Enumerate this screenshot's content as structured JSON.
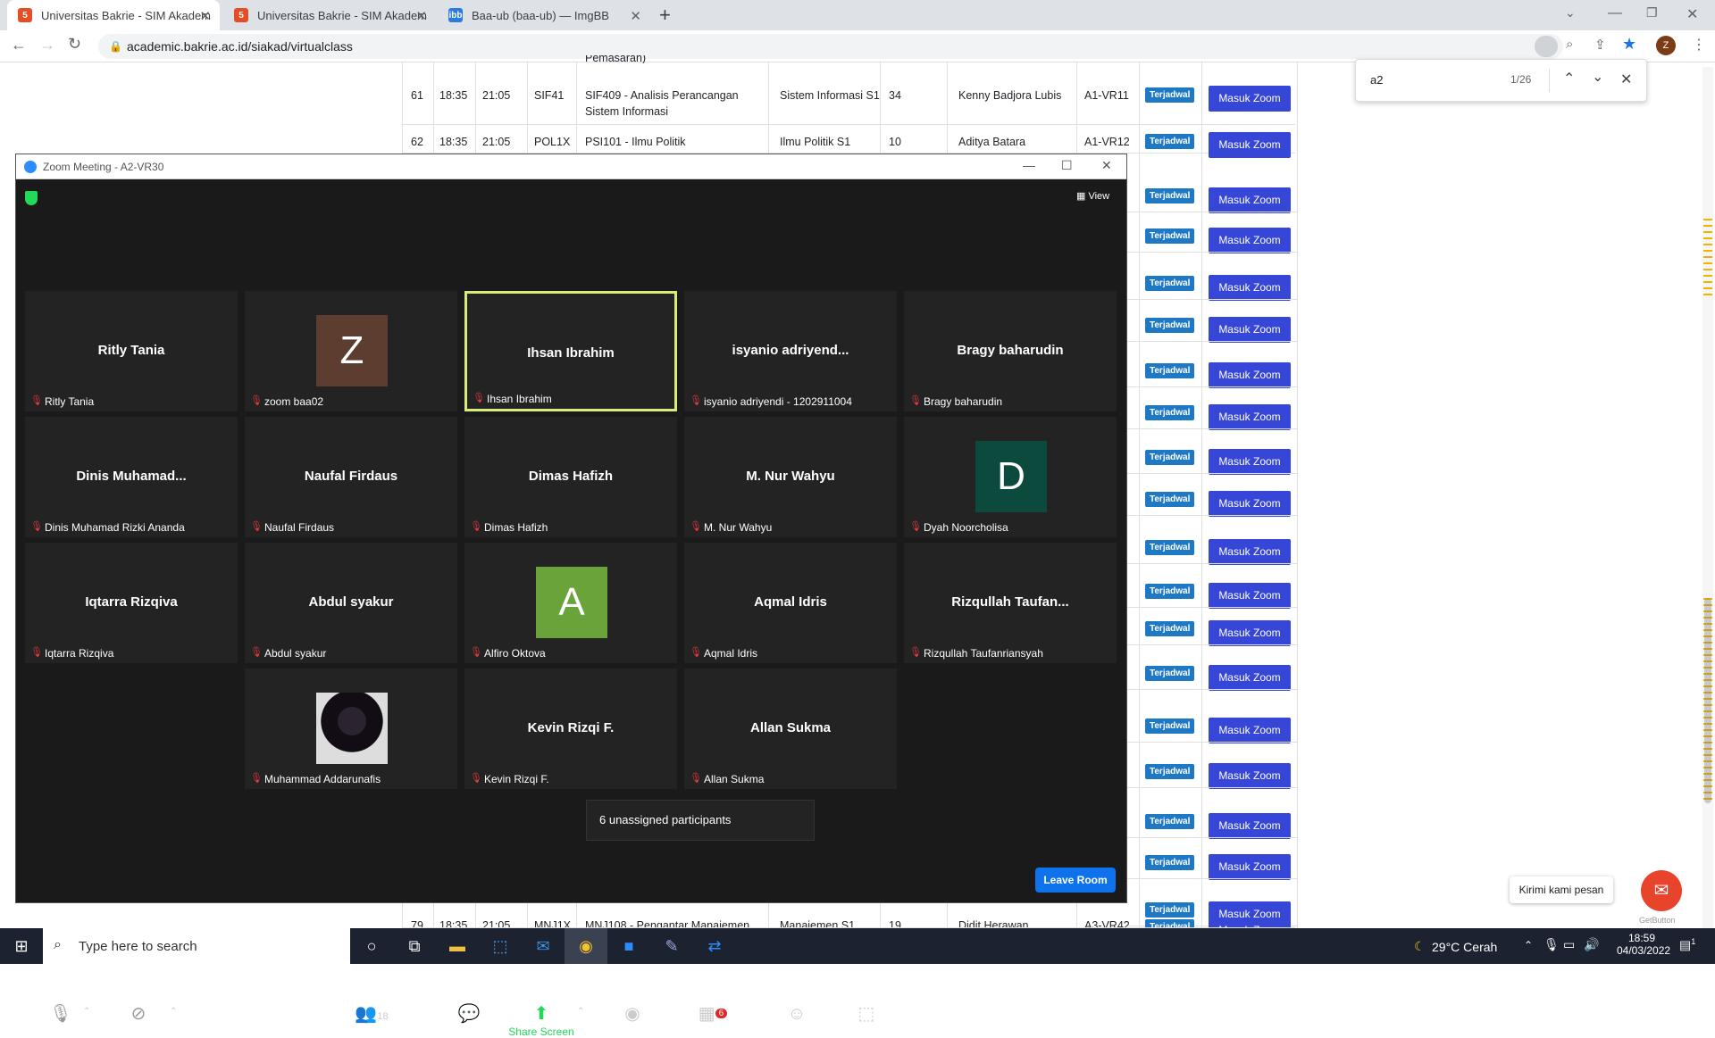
{
  "browser": {
    "tabs": [
      {
        "title": "Universitas Bakrie - SIM Akadem",
        "active": true
      },
      {
        "title": "Universitas Bakrie - SIM Akadem",
        "active": false
      },
      {
        "title": "Baa-ub (baa-ub) — ImgBB",
        "active": false
      }
    ],
    "new_tab": "+",
    "url": "academic.bakrie.ac.id/siakad/virtualclass",
    "profile_initial": "Z",
    "find": {
      "query": "a2",
      "count": "1/26"
    }
  },
  "page": {
    "partial_top": "Pemasaran)",
    "rows": [
      {
        "no": "61",
        "start": "18:35",
        "end": "21:05",
        "class": "SIF41",
        "course": "SIF409 - Analisis Perancangan Sistem Informasi",
        "program": "Sistem Informasi S1",
        "count": "34",
        "lecturer": "Kenny Badjora Lubis",
        "room": "A1-VR11"
      },
      {
        "no": "62",
        "start": "18:35",
        "end": "21:05",
        "class": "POL1X",
        "course": "PSI101 - Ilmu Politik",
        "program": "Ilmu Politik S1",
        "count": "10",
        "lecturer": "Aditya Batara",
        "room": "A1-VR12"
      },
      {
        "no": "79",
        "start": "18:35",
        "end": "21:05",
        "class": "MNJ1X",
        "course": "MNJ108 - Pengantar Manajemen",
        "program": "Manajemen S1",
        "count": "19",
        "lecturer": "Didit Herawan",
        "room": "A3-VR42"
      }
    ],
    "status_badge": "Terjadwal",
    "join_button": "Masuk Zoom",
    "chat_bubble": "Kirimi kami pesan",
    "getbutton": "GetButton"
  },
  "zoom": {
    "title": "Zoom Meeting - A2-VR30",
    "view_label": "View",
    "participants": [
      {
        "big": "Ritly Tania",
        "name": "Ritly Tania"
      },
      {
        "avatar": "Z",
        "avatar_color": "#5c3d30",
        "name": "zoom baa02"
      },
      {
        "big": "Ihsan Ibrahim",
        "name": "Ihsan Ibrahim",
        "speaking": true
      },
      {
        "big": "isyanio  adriyend...",
        "name": "isyanio adriyendi - 1202911004"
      },
      {
        "big": "Bragy baharudin",
        "name": "Bragy baharudin"
      },
      {
        "big": "Dinis  Muhamad...",
        "name": "Dinis Muhamad Rizki Ananda"
      },
      {
        "big": "Naufal Firdaus",
        "name": "Naufal Firdaus"
      },
      {
        "big": "Dimas Hafizh",
        "name": "Dimas Hafizh"
      },
      {
        "big": "M. Nur Wahyu",
        "name": "M. Nur Wahyu"
      },
      {
        "avatar": "D",
        "avatar_color": "#0b4a3c",
        "name": "Dyah Noorcholisa"
      },
      {
        "big": "Iqtarra Rizqiva",
        "name": "Iqtarra Rizqiva"
      },
      {
        "big": "Abdul syakur",
        "name": "Abdul syakur"
      },
      {
        "avatar": "A",
        "avatar_color": "#6aa33a",
        "name": "Alfiro Oktova"
      },
      {
        "big": "Aqmal Idris",
        "name": "Aqmal Idris"
      },
      {
        "big": "Rizqullah  Taufan...",
        "name": "Rizqullah Taufanriansyah"
      },
      {
        "photo": true,
        "name": "Muhammad Addarunafis"
      },
      {
        "big": "Kevin Rizqi F.",
        "name": "Kevin Rizqi F."
      },
      {
        "big": "Allan Sukma",
        "name": "Allan Sukma"
      }
    ],
    "unassigned": "6 unassigned participants",
    "controls": {
      "unmute": "Unmute",
      "start_video": "Start Video",
      "participants": "Participants",
      "participants_count": "18",
      "chat": "Chat",
      "share_screen": "Share Screen",
      "record": "Record",
      "breakout_rooms": "Breakout Rooms",
      "breakout_badge": "6",
      "reactions": "Reactions",
      "apps": "Apps",
      "leave": "Leave Room"
    }
  },
  "taskbar": {
    "search_placeholder": "Type here to search",
    "weather": "29°C  Cerah",
    "time": "18:59",
    "date": "04/03/2022",
    "notification_count": "1"
  }
}
